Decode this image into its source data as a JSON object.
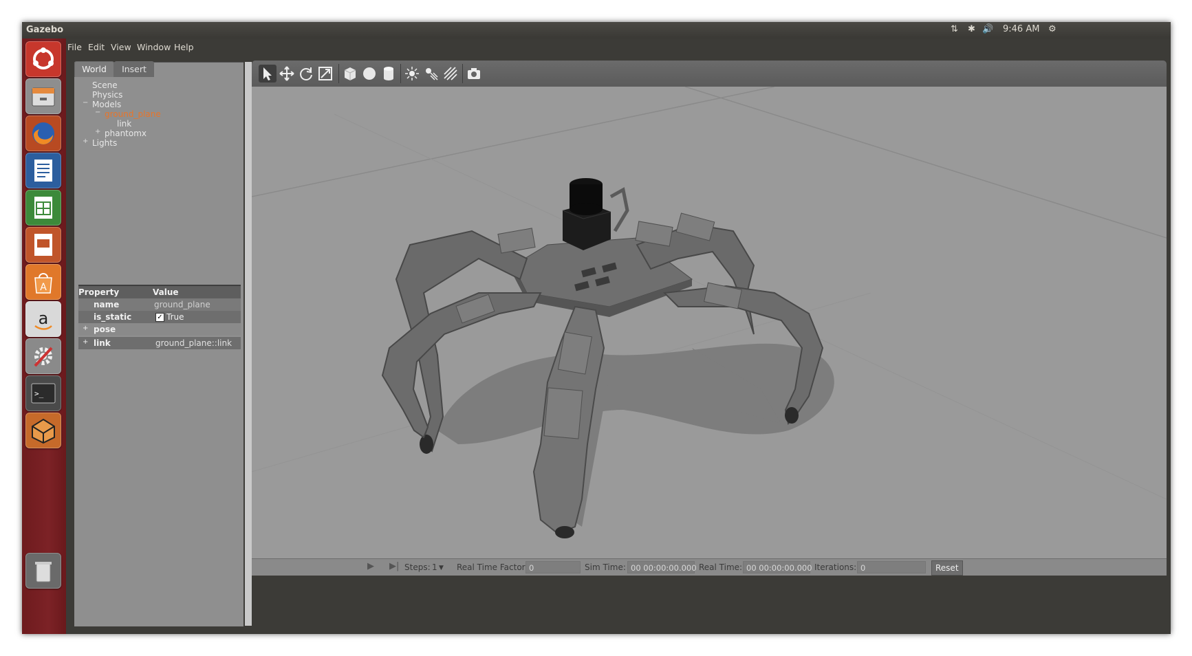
{
  "topbar": {
    "title": "Gazebo",
    "time": "9:46 AM"
  },
  "menubar": [
    "File",
    "Edit",
    "View",
    "Window",
    "Help"
  ],
  "left_panel": {
    "tabs": [
      "World",
      "Insert"
    ],
    "tree": [
      {
        "label": "Scene"
      },
      {
        "label": "Physics"
      },
      {
        "label": "Models"
      },
      {
        "label": "ground_plane"
      },
      {
        "label": "link"
      },
      {
        "label": "phantomx"
      },
      {
        "label": "Lights"
      }
    ],
    "properties": {
      "header": {
        "property": "Property",
        "value": "Value"
      },
      "rows": [
        {
          "name": "name",
          "value": "ground_plane"
        },
        {
          "name": "is_static",
          "value": "True"
        },
        {
          "name": "pose",
          "value": ""
        },
        {
          "name": "link",
          "value": "ground_plane::link"
        }
      ]
    }
  },
  "toolbar": {
    "tools": [
      "select-arrow-icon",
      "translate-icon",
      "rotate-icon",
      "scale-icon",
      "box-icon",
      "sphere-icon",
      "cylinder-icon",
      "point-light-icon",
      "spot-light-icon",
      "directional-light-icon",
      "screenshot-icon"
    ]
  },
  "statusbar": {
    "steps_label": "Steps:",
    "steps_value": "1",
    "rtf_label": "Real Time Factor:",
    "rtf_value": "0",
    "sim_time_label": "Sim Time:",
    "sim_time_value": "00 00:00:00.000",
    "real_time_label": "Real Time:",
    "real_time_value": "00 00:00:00.000",
    "iterations_label": "Iterations:",
    "iterations_value": "0",
    "reset_label": "Reset"
  },
  "colors": {
    "selected_tree_item": "#e8752a",
    "launcher": "#7c2226",
    "viewport": "#9a9a9a"
  },
  "launcher_icons": [
    "ubuntu-dash-icon",
    "files-icon",
    "firefox-icon",
    "writer-icon",
    "calc-icon",
    "impress-icon",
    "software-center-icon",
    "amazon-icon",
    "system-settings-icon",
    "terminal-icon",
    "gazebo-icon",
    "trash-icon"
  ]
}
